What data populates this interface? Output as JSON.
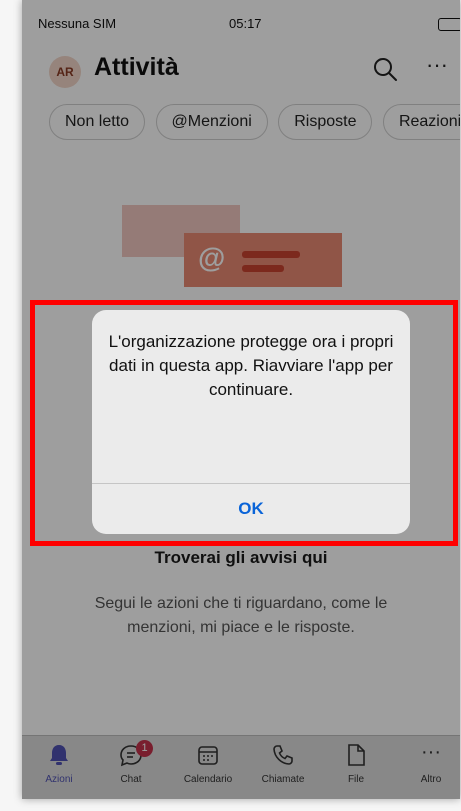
{
  "status": {
    "carrier": "Nessuna SIM",
    "time": "05:17"
  },
  "header": {
    "avatar": "AR",
    "title": "Attività"
  },
  "filters": [
    "Non letto",
    "@Menzioni",
    "Risposte",
    "Reazioni"
  ],
  "illustration": {
    "at_symbol": "@"
  },
  "empty_state": {
    "title": "Troverai gli avvisi qui",
    "description": "Segui le azioni che ti riguardano, come le menzioni, mi piace e le risposte."
  },
  "alert": {
    "message": "L'organizzazione protegge ora i propri dati in questa app. Riavviare l'app per continuare.",
    "ok_label": "OK"
  },
  "tabs": {
    "azioni": "Azioni",
    "chat": "Chat",
    "chat_badge": "1",
    "calendario": "Calendario",
    "chiamate": "Chiamate",
    "file": "File",
    "altro": "Altro"
  },
  "colors": {
    "accent": "#4f52b2",
    "badge": "#c4314b",
    "highlight": "#ff0000",
    "link": "#0a64d8"
  }
}
